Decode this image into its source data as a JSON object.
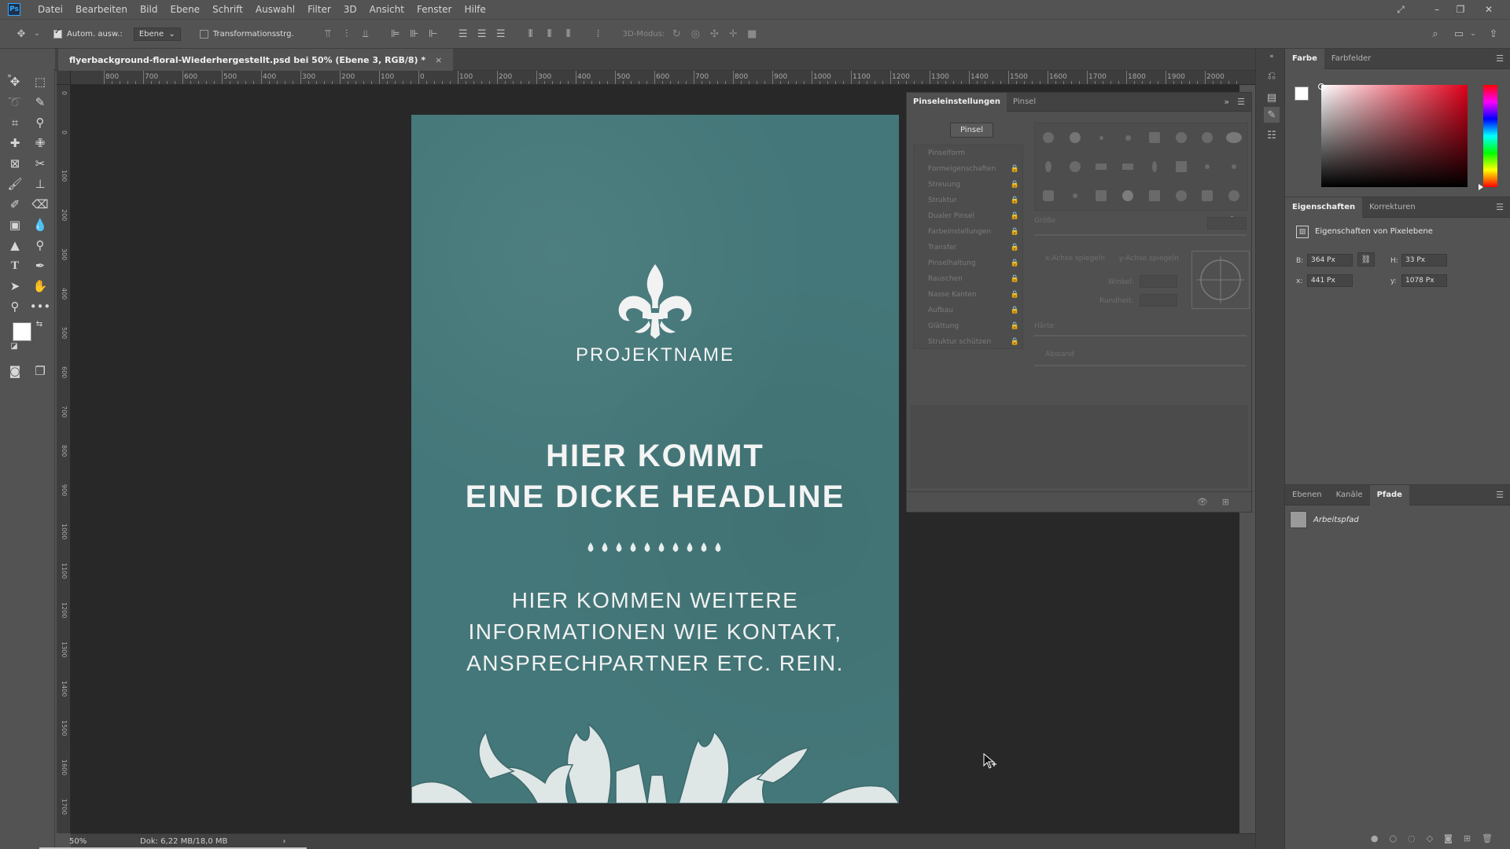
{
  "menubar": {
    "app_icon": "Ps",
    "items": [
      "Datei",
      "Bearbeiten",
      "Bild",
      "Ebene",
      "Schrift",
      "Auswahl",
      "Filter",
      "3D",
      "Ansicht",
      "Fenster",
      "Hilfe"
    ]
  },
  "options_bar": {
    "auto_select_label": "Autom. ausw.:",
    "auto_select_value": "Ebene",
    "transform_label": "Transformationsstrg.",
    "mode_3d_label": "3D-Modus:"
  },
  "document": {
    "tab_title": "flyerbackground-floral-Wiederhergestellt.psd bei 50% (Ebene 3, RGB/8) *",
    "close_symbol": "×",
    "zoom": "50%",
    "doc_size": "Dok: 6,22 MB/18,0 MB"
  },
  "ruler": {
    "h_labels": [
      "800",
      "700",
      "600",
      "500",
      "400",
      "300",
      "200",
      "100",
      "0",
      "100",
      "200",
      "300",
      "400",
      "500",
      "600",
      "700",
      "800",
      "900",
      "1000",
      "1100",
      "1200",
      "1300",
      "1400",
      "1500",
      "1600",
      "1700",
      "1800",
      "1900",
      "2000"
    ],
    "v_labels": [
      "0",
      "0",
      "100",
      "200",
      "300",
      "400",
      "500",
      "600",
      "700",
      "800",
      "900",
      "1000",
      "1100",
      "1200",
      "1300",
      "1400",
      "1500",
      "1600",
      "1700",
      "1800"
    ]
  },
  "flyer": {
    "project_name": "PROJEKTNAME",
    "headline_1": "HIER KOMMT",
    "headline_2": "EINE DICKE HEADLINE",
    "info_1": "HIER KOMMEN WEITERE",
    "info_2": "INFORMATIONEN WIE KONTAKT,",
    "info_3": "ANSPRECHPARTNER ETC. REIN.",
    "bg_color": "#447779",
    "text_color": "#f2f2f2"
  },
  "brush_panel": {
    "tabs": [
      "Pinseleinstellungen",
      "Pinsel"
    ],
    "brush_button": "Pinsel",
    "settings": [
      {
        "label": "Pinselform"
      },
      {
        "label": "Formeigenschaften"
      },
      {
        "label": "Streuung"
      },
      {
        "label": "Struktur"
      },
      {
        "label": "Dualer Pinsel"
      },
      {
        "label": "Farbeinstellungen"
      },
      {
        "label": "Transfer"
      },
      {
        "label": "Pinselhaltung"
      },
      {
        "label": "Rauschen"
      },
      {
        "label": "Nasse Kanten"
      },
      {
        "label": "Aufbau"
      },
      {
        "label": "Glättung"
      },
      {
        "label": "Struktur schützen"
      }
    ],
    "size_label": "Größe",
    "flip_x_label": "x-Achse spiegeln",
    "flip_y_label": "y-Achse spiegeln",
    "angle_label": "Winkel:",
    "roundness_label": "Rundheit:",
    "hardness_label": "Härte",
    "spacing_label": "Abstand"
  },
  "color_panel": {
    "tabs": [
      "Farbe",
      "Farbfelder"
    ]
  },
  "properties_panel": {
    "tabs": [
      "Eigenschaften",
      "Korrekturen"
    ],
    "title": "Eigenschaften von Pixelebene",
    "w_label": "B:",
    "w_value": "364 Px",
    "h_label": "H:",
    "h_value": "33 Px",
    "x_label": "x:",
    "x_value": "441 Px",
    "y_label": "y:",
    "y_value": "1078 Px"
  },
  "layers_panel": {
    "tabs": [
      "Ebenen",
      "Kanäle",
      "Pfade"
    ],
    "path_name": "Arbeitspfad"
  }
}
